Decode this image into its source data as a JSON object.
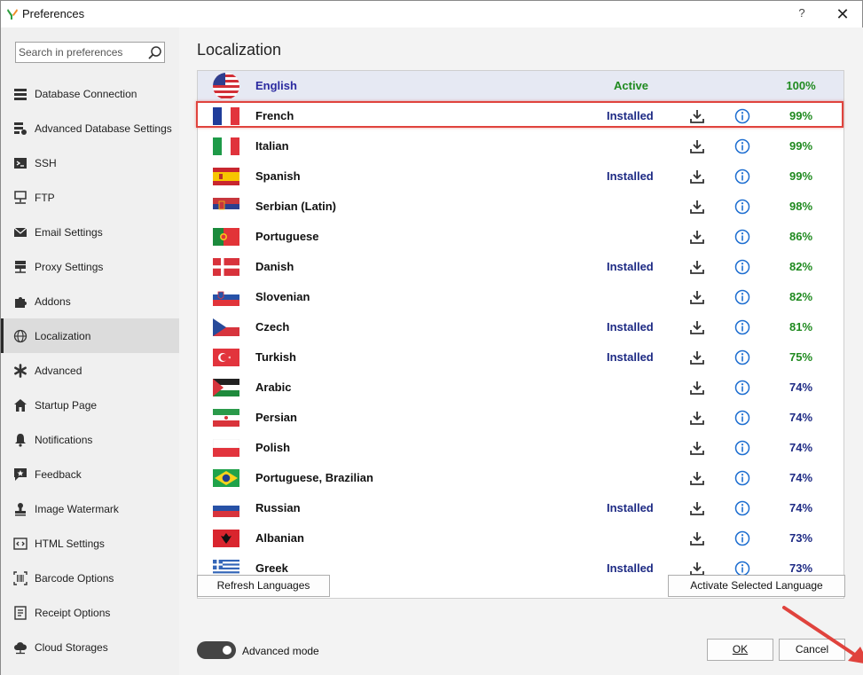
{
  "window": {
    "title": "Preferences",
    "help": "?",
    "close": "✕"
  },
  "sidebar": {
    "search_placeholder": "Search in preferences",
    "items": [
      {
        "label": "Database Connection",
        "icon": "database-icon"
      },
      {
        "label": "Advanced Database Settings",
        "icon": "database-settings-icon"
      },
      {
        "label": "SSH",
        "icon": "terminal-icon"
      },
      {
        "label": "FTP",
        "icon": "network-icon"
      },
      {
        "label": "Email Settings",
        "icon": "envelope-icon"
      },
      {
        "label": "Proxy Settings",
        "icon": "server-icon"
      },
      {
        "label": "Addons",
        "icon": "puzzle-icon"
      },
      {
        "label": "Localization",
        "icon": "globe-icon"
      },
      {
        "label": "Advanced",
        "icon": "asterisk-icon"
      },
      {
        "label": "Startup Page",
        "icon": "home-icon"
      },
      {
        "label": "Notifications",
        "icon": "bell-icon"
      },
      {
        "label": "Feedback",
        "icon": "feedback-icon"
      },
      {
        "label": "Image Watermark",
        "icon": "stamp-icon"
      },
      {
        "label": "HTML Settings",
        "icon": "code-icon"
      },
      {
        "label": "Barcode Options",
        "icon": "barcode-icon"
      },
      {
        "label": "Receipt Options",
        "icon": "receipt-icon"
      },
      {
        "label": "Cloud Storages",
        "icon": "cloud-icon"
      }
    ],
    "active_index": 7
  },
  "main": {
    "title": "Localization",
    "languages": [
      {
        "name": "English",
        "status": "Active",
        "percent": "100%",
        "flag": "us"
      },
      {
        "name": "French",
        "status": "Installed",
        "percent": "99%",
        "flag": "fr"
      },
      {
        "name": "Italian",
        "status": "",
        "percent": "99%",
        "flag": "it"
      },
      {
        "name": "Spanish",
        "status": "Installed",
        "percent": "99%",
        "flag": "es"
      },
      {
        "name": "Serbian (Latin)",
        "status": "",
        "percent": "98%",
        "flag": "rs"
      },
      {
        "name": "Portuguese",
        "status": "",
        "percent": "86%",
        "flag": "pt"
      },
      {
        "name": "Danish",
        "status": "Installed",
        "percent": "82%",
        "flag": "dk"
      },
      {
        "name": "Slovenian",
        "status": "",
        "percent": "82%",
        "flag": "si"
      },
      {
        "name": "Czech",
        "status": "Installed",
        "percent": "81%",
        "flag": "cz"
      },
      {
        "name": "Turkish",
        "status": "Installed",
        "percent": "75%",
        "flag": "tr"
      },
      {
        "name": "Arabic",
        "status": "",
        "percent": "74%",
        "flag": "ar"
      },
      {
        "name": "Persian",
        "status": "",
        "percent": "74%",
        "flag": "ir"
      },
      {
        "name": "Polish",
        "status": "",
        "percent": "74%",
        "flag": "pl"
      },
      {
        "name": "Portuguese, Brazilian",
        "status": "",
        "percent": "74%",
        "flag": "br"
      },
      {
        "name": "Russian",
        "status": "Installed",
        "percent": "74%",
        "flag": "ru"
      },
      {
        "name": "Albanian",
        "status": "",
        "percent": "73%",
        "flag": "al"
      },
      {
        "name": "Greek",
        "status": "Installed",
        "percent": "73%",
        "flag": "gr"
      }
    ],
    "selected_language": "French",
    "refresh_label": "Refresh Languages",
    "activate_label": "Activate Selected Language",
    "advanced_mode_label": "Advanced mode",
    "advanced_mode_on": true,
    "ok_label": "OK",
    "cancel_label": "Cancel"
  },
  "colors": {
    "green": "#1f8a1f",
    "navy": "#1d2a84",
    "highlight": "#e0433d"
  }
}
